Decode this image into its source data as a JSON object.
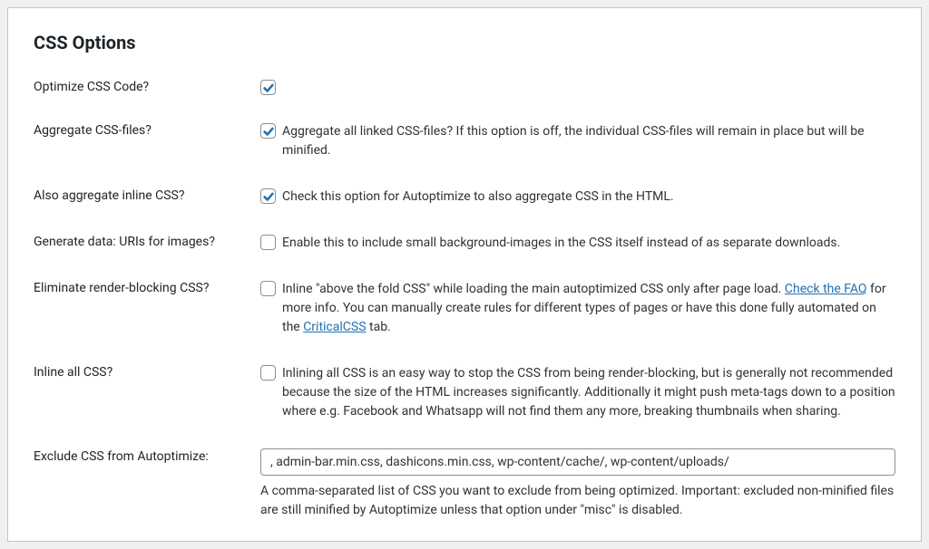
{
  "section_title": "CSS Options",
  "rows": {
    "optimize_css": {
      "label": "Optimize CSS Code?",
      "checked": true,
      "desc": ""
    },
    "aggregate_css": {
      "label": "Aggregate CSS-files?",
      "checked": true,
      "desc": "Aggregate all linked CSS-files? If this option is off, the individual CSS-files will remain in place but will be minified."
    },
    "aggregate_inline": {
      "label": "Also aggregate inline CSS?",
      "checked": true,
      "desc": "Check this option for Autoptimize to also aggregate CSS in the HTML."
    },
    "data_uris": {
      "label": "Generate data: URIs for images?",
      "checked": false,
      "desc": "Enable this to include small background-images in the CSS itself instead of as separate downloads."
    },
    "render_blocking": {
      "label": "Eliminate render-blocking CSS?",
      "checked": false,
      "desc_pre": "Inline \"above the fold CSS\" while loading the main autoptimized CSS only after page load. ",
      "link_faq": "Check the FAQ",
      "desc_mid": " for more info. You can manually create rules for different types of pages or have this done fully automated on the ",
      "link_critical": "CriticalCSS",
      "desc_post": " tab."
    },
    "inline_all": {
      "label": "Inline all CSS?",
      "checked": false,
      "desc": "Inlining all CSS is an easy way to stop the CSS from being render-blocking, but is generally not recommended because the size of the HTML increases significantly. Additionally it might push meta-tags down to a position where e.g. Facebook and Whatsapp will not find them any more, breaking thumbnails when sharing."
    },
    "exclude": {
      "label": "Exclude CSS from Autoptimize:",
      "value": ", admin-bar.min.css, dashicons.min.css, wp-content/cache/, wp-content/uploads/",
      "help": "A comma-separated list of CSS you want to exclude from being optimized. Important: excluded non-minified files are still minified by Autoptimize unless that option under \"misc\" is disabled."
    }
  }
}
